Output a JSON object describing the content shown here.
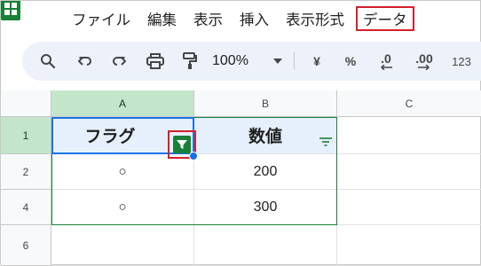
{
  "app": {
    "logo_icon": "sheets-logo-icon",
    "accent_green": "#188038",
    "highlight_red": "#d3202b",
    "selection_blue": "#1a73e8"
  },
  "menu": {
    "items": [
      {
        "label": "ファイル"
      },
      {
        "label": "編集"
      },
      {
        "label": "表示"
      },
      {
        "label": "挿入"
      },
      {
        "label": "表示形式"
      },
      {
        "label": "データ",
        "highlighted": true
      }
    ]
  },
  "toolbar": {
    "zoom": "100%",
    "currency_label": "¥",
    "percent_label": "%",
    "decrease_decimal_label": ".0",
    "increase_decimal_label": ".00",
    "number_format_label": "123",
    "icons": [
      "search-icon",
      "undo-icon",
      "redo-icon",
      "print-icon",
      "paint-format-icon",
      "zoom-dropdown-icon"
    ]
  },
  "grid": {
    "columns": [
      {
        "label": "A",
        "selected": true
      },
      {
        "label": "B",
        "selected": false
      },
      {
        "label": "C",
        "selected": false
      }
    ],
    "rows": [
      {
        "label": "1",
        "cells": [
          "フラグ",
          "数値",
          ""
        ],
        "selected": true
      },
      {
        "label": "2",
        "cells": [
          "○",
          "200",
          ""
        ]
      },
      {
        "label": "4",
        "cells": [
          "○",
          "300",
          ""
        ]
      },
      {
        "label": "6",
        "cells": [
          "",
          "",
          ""
        ]
      }
    ],
    "filter": {
      "column_a_state": "filtered",
      "column_b_state": "unfiltered"
    }
  }
}
